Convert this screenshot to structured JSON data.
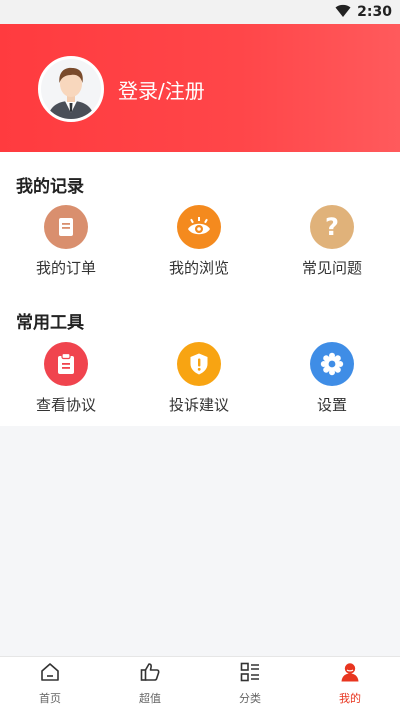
{
  "status_bar": {
    "time": "2:30"
  },
  "header": {
    "login_label": "登录/注册"
  },
  "records": {
    "title": "我的记录",
    "items": [
      {
        "label": "我的订单",
        "icon": "order-icon",
        "color": "#d98f6e"
      },
      {
        "label": "我的浏览",
        "icon": "eye-icon",
        "color": "#f48a1e"
      },
      {
        "label": "常见问题",
        "icon": "question-icon",
        "color": "#e0b27a"
      }
    ]
  },
  "tools": {
    "title": "常用工具",
    "items": [
      {
        "label": "查看协议",
        "icon": "clipboard-icon",
        "color": "#f0444e"
      },
      {
        "label": "投诉建议",
        "icon": "shield-exclamation-icon",
        "color": "#f8a412"
      },
      {
        "label": "设置",
        "icon": "gear-icon",
        "color": "#3f8de6"
      }
    ]
  },
  "tabbar": {
    "items": [
      {
        "label": "首页",
        "icon": "home-icon",
        "active": false
      },
      {
        "label": "超值",
        "icon": "thumbs-up-icon",
        "active": false
      },
      {
        "label": "分类",
        "icon": "category-icon",
        "active": false
      },
      {
        "label": "我的",
        "icon": "user-icon",
        "active": true
      }
    ],
    "active_color": "#e8351f"
  },
  "colors": {
    "header_start": "#ff3b3f",
    "header_end": "#ff5a5c",
    "background": "#f5f6f8"
  }
}
